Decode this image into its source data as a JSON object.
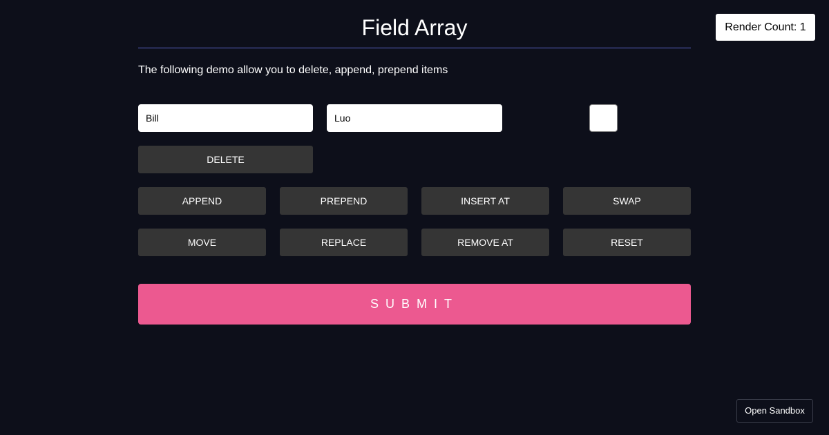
{
  "render_count_label": "Render Count: 1",
  "page": {
    "title": "Field Array",
    "description": "The following demo allow you to delete, append, prepend items"
  },
  "row_item": {
    "first_name": "Bill",
    "last_name": "Luo",
    "checkbox_checked": false,
    "delete_label": "DELETE"
  },
  "actions": {
    "append": "APPEND",
    "prepend": "PREPEND",
    "insert_at": "INSERT AT",
    "swap": "SWAP",
    "move": "MOVE",
    "replace": "REPLACE",
    "remove_at": "REMOVE AT",
    "reset": "RESET"
  },
  "submit_label": "SUBMIT",
  "sandbox_label": "Open Sandbox",
  "colors": {
    "background": "#0d0f1a",
    "button": "#353535",
    "submit": "#ec5990",
    "divider": "#5b64c9"
  }
}
